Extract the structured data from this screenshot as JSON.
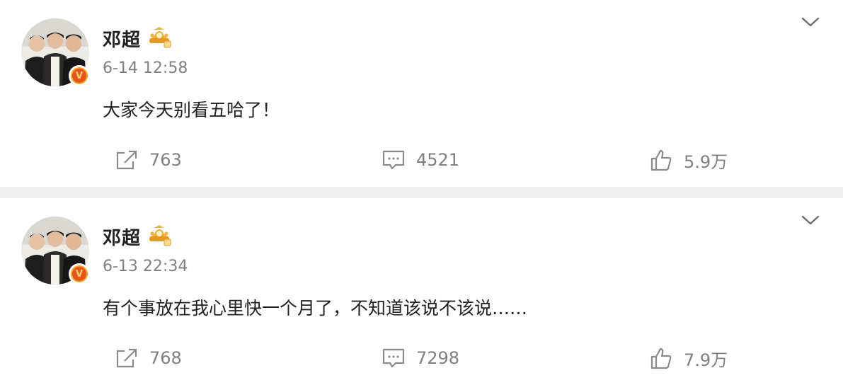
{
  "posts": [
    {
      "author": "邓超",
      "time": "6-14 12:58",
      "content": "大家今天别看五哈了！",
      "reposts": "763",
      "comments": "4521",
      "likes": "5.9万"
    },
    {
      "author": "邓超",
      "time": "6-13 22:34",
      "content": "有个事放在我心里快一个月了，不知道该说不该说……",
      "reposts": "768",
      "comments": "7298",
      "likes": "7.9万"
    }
  ],
  "icons": {
    "more": "chevron-down-icon",
    "repost": "share-icon",
    "comment": "comment-icon",
    "like": "thumbs-up-icon",
    "verified": "verified-v-icon",
    "badge": "gold-crown-badge-icon"
  },
  "colors": {
    "verified_outer": "#f6a623",
    "verified_inner": "#e8531b",
    "badge_gold": "#f2b53a",
    "text_muted": "#808080",
    "divider": "#eeeeee"
  }
}
